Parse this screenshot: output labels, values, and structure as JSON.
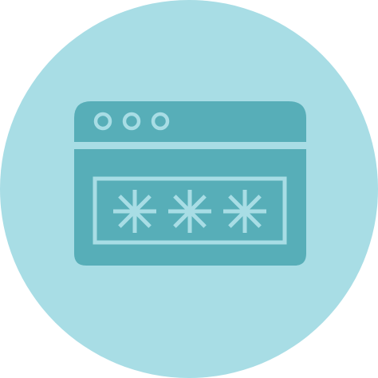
{
  "icon": {
    "name": "browser-password-icon",
    "elements": [
      "window-dots-icon",
      "password-field",
      "asterisk-icon"
    ],
    "masked_character_count": 3
  },
  "colors": {
    "page_background": "#ffffff",
    "circle_background": "#a8dde5",
    "window_fill": "#57aeb8",
    "accent_light": "#a8dde5"
  }
}
